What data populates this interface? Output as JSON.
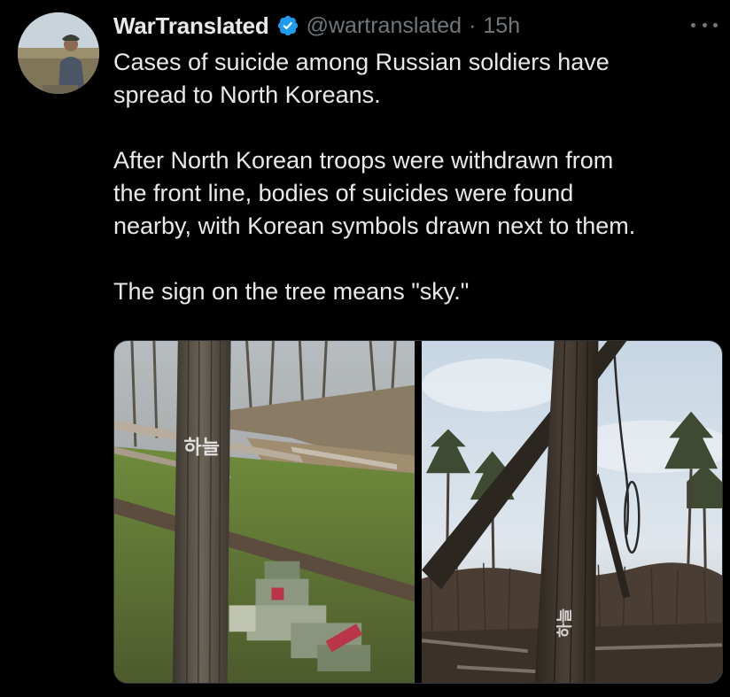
{
  "author": {
    "display_name": "WarTranslated",
    "handle": "@wartranslated",
    "separator": "·",
    "time": "15h",
    "verified": true,
    "avatar_icon": "user-avatar-soldier"
  },
  "more_icon": "more-horizontal-icon",
  "tweet": {
    "line1": "Cases of suicide among Russian soldiers have",
    "line2": "spread to North Koreans.",
    "line3": "After North Korean troops were withdrawn from",
    "line4": "the front line, bodies of suicides were found",
    "line5": "nearby, with Korean symbols drawn next to them.",
    "line6": "The sign on the tree means \"sky.\""
  },
  "media": {
    "left_tree_text": "하늘",
    "right_tree_text": "하늘"
  },
  "colors": {
    "background": "#000000",
    "text": "#e7e9ea",
    "secondary": "#71767b",
    "verified": "#1d9bf0"
  }
}
